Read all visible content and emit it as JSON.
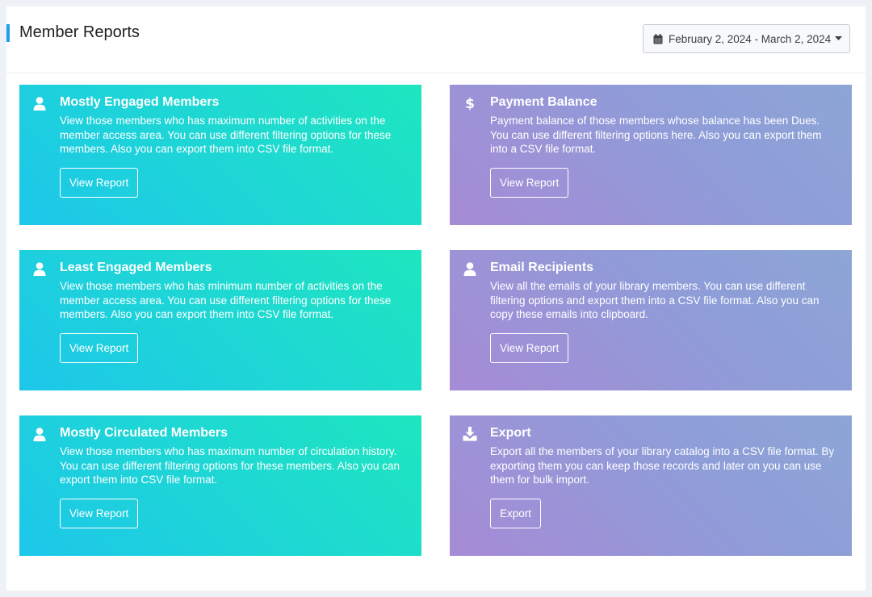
{
  "header": {
    "title": "Member Reports",
    "date_range": "February 2, 2024 - March 2, 2024",
    "date_icon": "calendar-icon",
    "caret_icon": "caret-down-icon"
  },
  "colors": {
    "accent": "#1e9fe8",
    "teal_start": "#1dc7ea",
    "teal_end": "#1ee6bf",
    "purple_start": "#a68bd6",
    "purple_end": "#8da6d6"
  },
  "cards": [
    {
      "title": "Mostly Engaged Members",
      "icon": "user-icon",
      "description": "View those members who has maximum number of activities on the member access area. You can use different filtering options for these members. Also you can export them into CSV file format.",
      "button": "View Report"
    },
    {
      "title": "Payment Balance",
      "icon": "dollar-icon",
      "description": "Payment balance of those members whose balance has been Dues. You can use different filtering options here. Also you can export them into a CSV file format.",
      "button": "View Report"
    },
    {
      "title": "Least Engaged Members",
      "icon": "user-icon",
      "description": "View those members who has minimum number of activities on the member access area. You can use different filtering options for these members. Also you can export them into CSV file format.",
      "button": "View Report"
    },
    {
      "title": "Email Recipients",
      "icon": "user-icon",
      "description": "View all the emails of your library members. You can use different filtering options and export them into a CSV file format. Also you can copy these emails into clipboard.",
      "button": "View Report"
    },
    {
      "title": "Mostly Circulated Members",
      "icon": "user-icon",
      "description": "View those members who has maximum number of circulation history. You can use different filtering options for these members. Also you can export them into CSV file format.",
      "button": "View Report"
    },
    {
      "title": "Export",
      "icon": "download-icon",
      "description": "Export all the members of your library catalog into a CSV file format. By exporting them you can keep those records and later on you can use them for bulk import.",
      "button": "Export"
    }
  ]
}
